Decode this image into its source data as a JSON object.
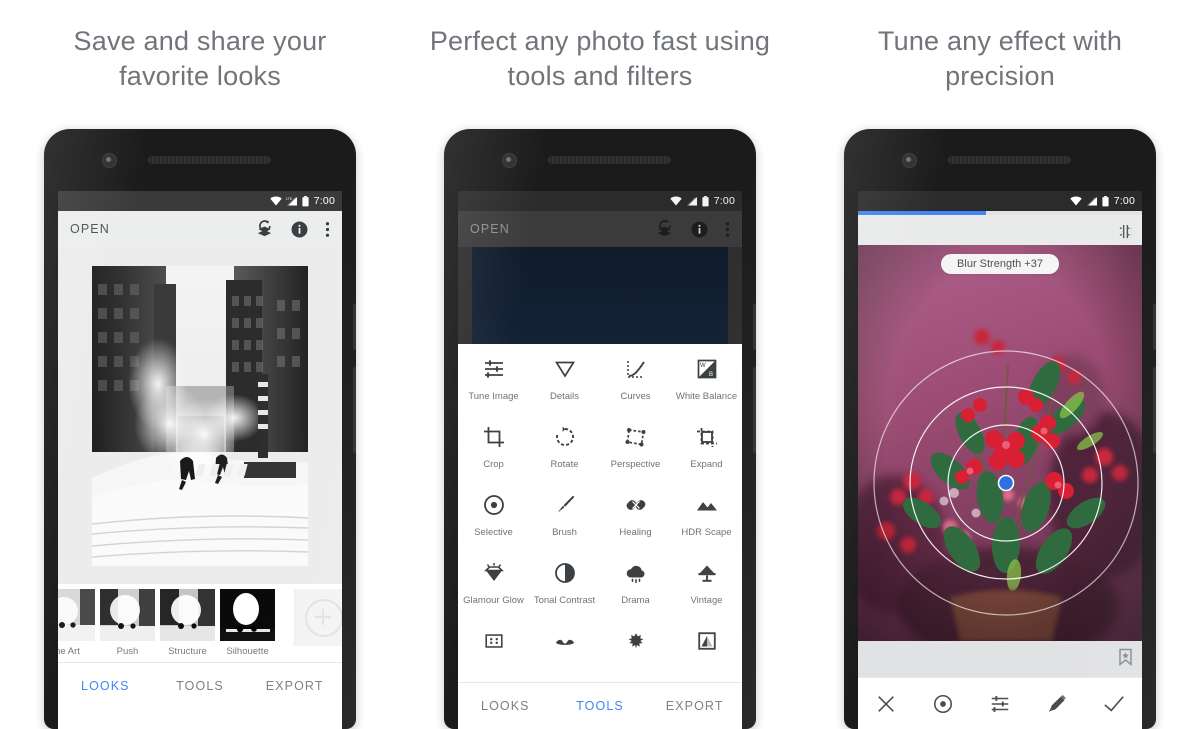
{
  "panels": [
    {
      "heading": "Save and share your favorite looks",
      "status": {
        "time": "7:00",
        "wifi": "wifi-icon",
        "signal": "signal-icon",
        "battery": "battery-icon"
      },
      "appbar": {
        "open_label": "OPEN",
        "icons": [
          "undo-stack-icon",
          "info-icon",
          "overflow-menu-icon"
        ]
      },
      "looks": [
        {
          "label": "ne Art"
        },
        {
          "label": "Push"
        },
        {
          "label": "Structure"
        },
        {
          "label": "Silhouette"
        }
      ],
      "add_look": "add-look-icon",
      "tabs": [
        {
          "label": "LOOKS",
          "active": true
        },
        {
          "label": "TOOLS",
          "active": false
        },
        {
          "label": "EXPORT",
          "active": false
        }
      ]
    },
    {
      "heading": "Perfect any photo fast using tools and filters",
      "status": {
        "time": "7:00"
      },
      "appbar": {
        "open_label": "OPEN"
      },
      "tools": [
        {
          "label": "Tune Image",
          "icon": "tune-image-icon"
        },
        {
          "label": "Details",
          "icon": "details-icon"
        },
        {
          "label": "Curves",
          "icon": "curves-icon"
        },
        {
          "label": "White Balance",
          "icon": "white-balance-icon"
        },
        {
          "label": "Crop",
          "icon": "crop-icon"
        },
        {
          "label": "Rotate",
          "icon": "rotate-icon"
        },
        {
          "label": "Perspective",
          "icon": "perspective-icon"
        },
        {
          "label": "Expand",
          "icon": "expand-icon"
        },
        {
          "label": "Selective",
          "icon": "selective-icon"
        },
        {
          "label": "Brush",
          "icon": "brush-icon"
        },
        {
          "label": "Healing",
          "icon": "healing-icon"
        },
        {
          "label": "HDR Scape",
          "icon": "hdr-scape-icon"
        },
        {
          "label": "Glamour Glow",
          "icon": "glamour-glow-icon"
        },
        {
          "label": "Tonal Contrast",
          "icon": "tonal-contrast-icon"
        },
        {
          "label": "Drama",
          "icon": "drama-icon"
        },
        {
          "label": "Vintage",
          "icon": "vintage-icon"
        },
        {
          "label": "",
          "icon": "grainy-film-icon"
        },
        {
          "label": "",
          "icon": "retrolux-icon"
        },
        {
          "label": "",
          "icon": "grunge-icon"
        },
        {
          "label": "",
          "icon": "frames-icon"
        }
      ],
      "tabs": [
        {
          "label": "LOOKS",
          "active": false
        },
        {
          "label": "TOOLS",
          "active": true
        },
        {
          "label": "EXPORT",
          "active": false
        }
      ]
    },
    {
      "heading": "Tune any effect with precision",
      "status": {
        "time": "7:00"
      },
      "chip_label": "Blur Strength +37",
      "progress_percent": 45,
      "compare_icon": "compare-icon",
      "bookmark_icon": "bookmark-icon",
      "bottom_icons": [
        "close-icon",
        "control-point-icon",
        "adjust-sliders-icon",
        "stack-brush-icon",
        "check-icon"
      ]
    }
  ],
  "colors": {
    "accent": "#4285f4",
    "heading_text": "#71757a",
    "tab_inactive": "#7c7f82",
    "appbar_bg": "#eceded",
    "phone_body": "#1b1b1b"
  }
}
